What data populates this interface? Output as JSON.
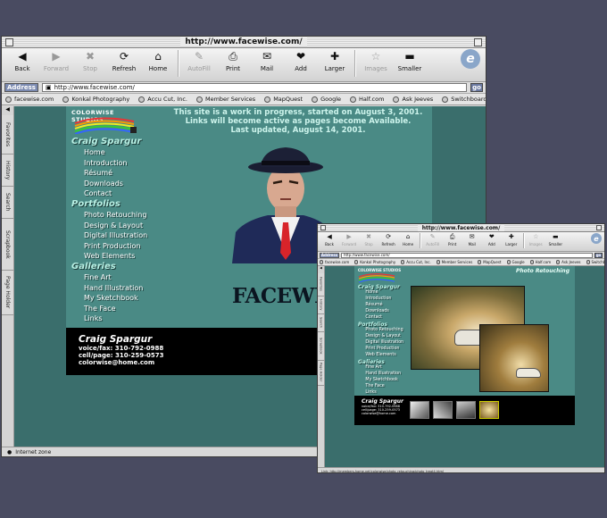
{
  "main_window": {
    "title": "http://www.facewise.com/",
    "toolbar": [
      {
        "label": "Back",
        "icon": "back-arrow-icon",
        "glyph": "◀",
        "enabled": true
      },
      {
        "label": "Forward",
        "icon": "forward-arrow-icon",
        "glyph": "▶",
        "enabled": false
      },
      {
        "label": "Stop",
        "icon": "stop-icon",
        "glyph": "✖",
        "enabled": false
      },
      {
        "label": "Refresh",
        "icon": "refresh-icon",
        "glyph": "⟳",
        "enabled": true
      },
      {
        "label": "Home",
        "icon": "home-icon",
        "glyph": "⌂",
        "enabled": true
      },
      {
        "label": "AutoFill",
        "icon": "autofill-icon",
        "glyph": "✎",
        "enabled": false
      },
      {
        "label": "Print",
        "icon": "print-icon",
        "glyph": "⎙",
        "enabled": true
      },
      {
        "label": "Mail",
        "icon": "mail-icon",
        "glyph": "✉",
        "enabled": true
      },
      {
        "label": "Add",
        "icon": "add-favorite-icon",
        "glyph": "❤",
        "enabled": true
      },
      {
        "label": "Larger",
        "icon": "larger-text-icon",
        "glyph": "✚",
        "enabled": true
      },
      {
        "label": "Images",
        "icon": "images-icon",
        "glyph": "☆",
        "enabled": false
      },
      {
        "label": "Smaller",
        "icon": "smaller-text-icon",
        "glyph": "▬",
        "enabled": true
      }
    ],
    "address_label": "Address",
    "address_value": "http://www.facewise.com/",
    "go_label": "go",
    "favorites": [
      "facewise.com",
      "Konkal Photography",
      "Accu Cut, Inc.",
      "Member Services",
      "MapQuest",
      "Google",
      "Half.com",
      "Ask Jeeves",
      "Switchboard"
    ],
    "side_tabs": [
      "Favorites",
      "History",
      "Search",
      "Scrapbook",
      "Page Holder"
    ],
    "status_text": "Internet zone"
  },
  "site": {
    "logo_text": "COLORWISE STUDIOS",
    "name": "Craig Spargur",
    "notice": [
      "This site is a work in progress, started on August 3, 2001.",
      "Links will become active as pages become Available.",
      "Last updated, August 14, 2001."
    ],
    "sections": [
      {
        "title": "Craig Spargur",
        "links": [
          "Home",
          "Introduction",
          "Résumé",
          "Downloads",
          "Contact"
        ]
      },
      {
        "title": "Portfolios",
        "links": [
          "Photo Retouching",
          "Design & Layout",
          "Digital Illustration",
          "Print Production",
          "Web Elements"
        ]
      },
      {
        "title": "Galleries",
        "links": [
          "Fine Art",
          "Hand Illustration",
          "My Sketchbook",
          "The Face",
          "Links"
        ]
      }
    ],
    "banner_text": "FACEWISE",
    "contact": {
      "name": "Craig Spargur",
      "phone1": "voice/fax: 310-792-0988",
      "phone2": "cell/page: 310-259-0573",
      "email": "colorwise@home.com"
    }
  },
  "second_window": {
    "title": "http://www.facewise.com/",
    "address_value": "http://www.facewise.com/",
    "page_heading": "Photo Retouching",
    "status_text": "Link: http://members.home.net/colorwise/photo_retouching/photo_treat4.html"
  },
  "colors": {
    "desktop": "#494b61",
    "page_bg": "#3a6e6c",
    "panel": "#4a8a85",
    "accent": "#b8f0e4"
  }
}
